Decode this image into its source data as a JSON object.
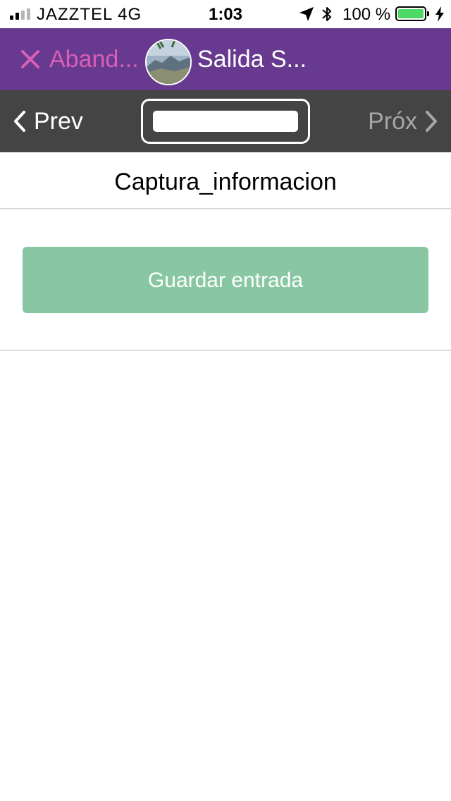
{
  "status_bar": {
    "carrier": "JAZZTEL   4G",
    "time": "1:03",
    "battery_percent": "100 %",
    "battery_level": 1.0,
    "signal_bars_active": 2,
    "signal_bars_total": 4,
    "icons": [
      "signal-icon",
      "location-arrow-icon",
      "bluetooth-icon",
      "battery-icon",
      "charging-bolt-icon"
    ]
  },
  "header": {
    "abandon_label": "Aband...",
    "title": "Salida S...",
    "colors": {
      "background": "#673a8f",
      "abandon": "#d95fb6",
      "title": "#ffffff"
    }
  },
  "nav": {
    "prev_label": "Prev",
    "next_label": "Próx",
    "page_value": "",
    "colors": {
      "background": "#444444",
      "prev": "#ffffff",
      "next_disabled": "#a7a7a7"
    }
  },
  "content": {
    "heading": "Captura_informacion",
    "save_button_label": "Guardar entrada",
    "colors": {
      "save_button": "#88c7a2"
    }
  }
}
